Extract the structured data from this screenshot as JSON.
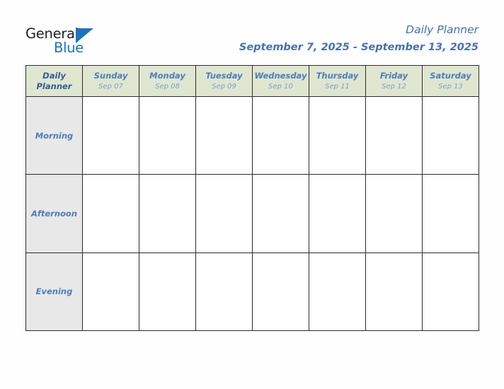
{
  "brand": {
    "logo_word_1": "General",
    "logo_word_2": "Blue",
    "logo_color_dark": "#231f20",
    "logo_color_blue": "#1b72bd",
    "triangle_icon": "triangle-icon"
  },
  "header": {
    "title": "Daily Planner",
    "date_range": "September 7, 2025 - September 13, 2025",
    "title_color": "#4472b4"
  },
  "table": {
    "corner_label_line1": "Daily",
    "corner_label_line2": "Planner",
    "header_bg": "#dfe6d0",
    "label_bg": "#e8e8e8",
    "border_color": "#2b2b2b",
    "days": [
      {
        "name": "Sunday",
        "date": "Sep 07"
      },
      {
        "name": "Monday",
        "date": "Sep 08"
      },
      {
        "name": "Tuesday",
        "date": "Sep 09"
      },
      {
        "name": "Wednesday",
        "date": "Sep 10"
      },
      {
        "name": "Thursday",
        "date": "Sep 11"
      },
      {
        "name": "Friday",
        "date": "Sep 12"
      },
      {
        "name": "Saturday",
        "date": "Sep 13"
      }
    ],
    "slots": [
      {
        "label": "Morning",
        "entries": [
          "",
          "",
          "",
          "",
          "",
          "",
          ""
        ]
      },
      {
        "label": "Afternoon",
        "entries": [
          "",
          "",
          "",
          "",
          "",
          "",
          ""
        ]
      },
      {
        "label": "Evening",
        "entries": [
          "",
          "",
          "",
          "",
          "",
          "",
          ""
        ]
      }
    ]
  }
}
